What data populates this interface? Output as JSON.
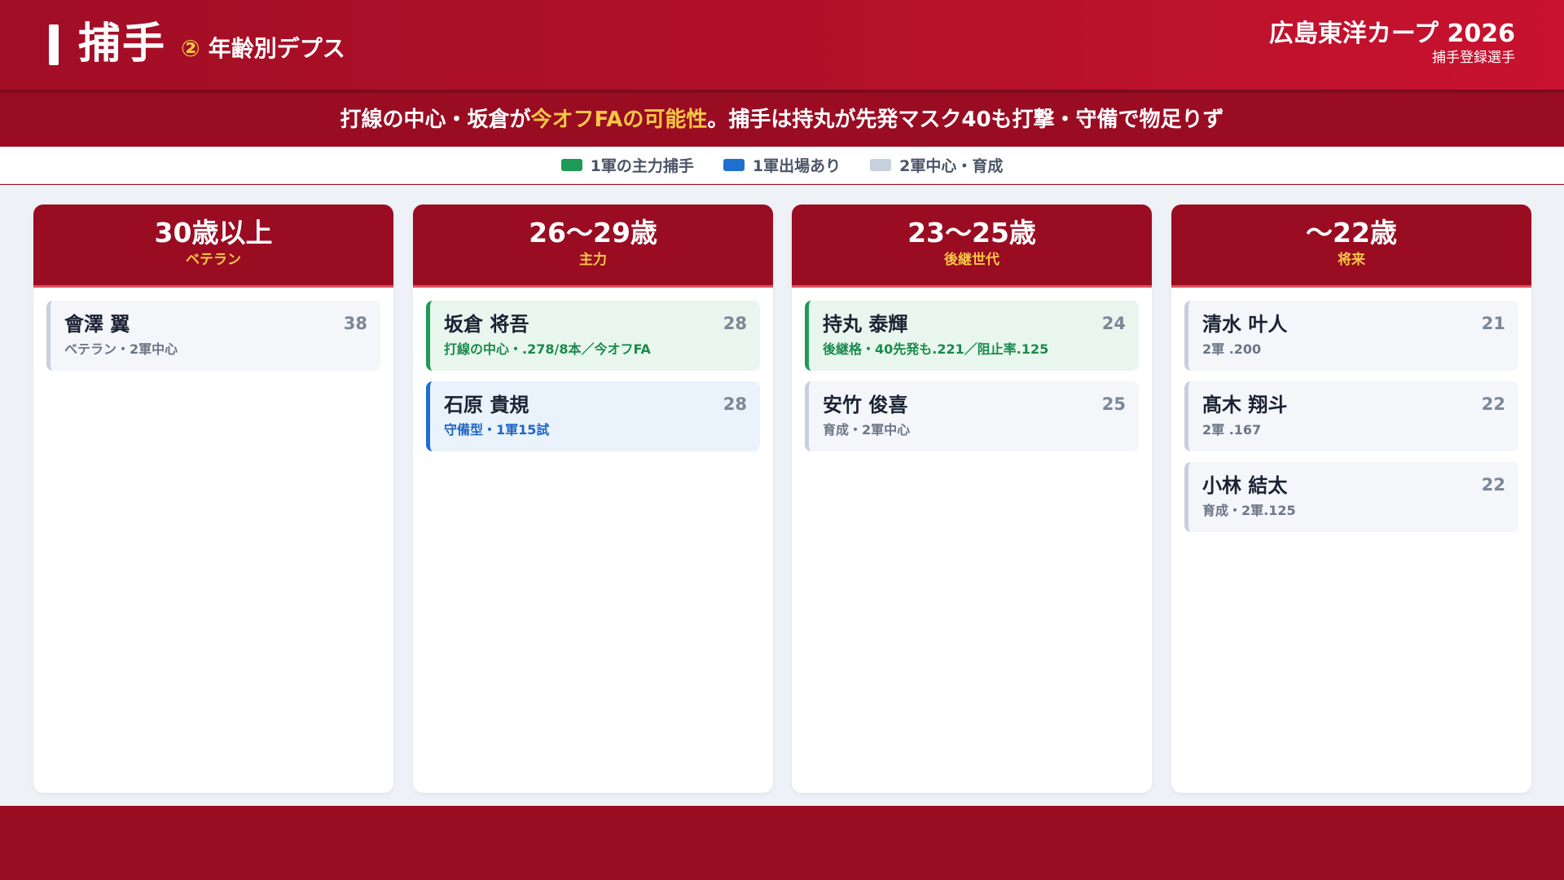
{
  "header": {
    "title": "捕手",
    "sub_num": "②",
    "sub_title": "年齢別デプス",
    "brand_name": "広島東洋カープ 2026",
    "brand_sub": "捕手登録選手"
  },
  "banner": {
    "part1": "打線の中心・坂倉が",
    "highlight": "今オフFAの可能性",
    "part2": "。捕手は持丸が先発マスク40も打撃・守備で物足りず"
  },
  "legend": [
    {
      "label": "1軍の主力捕手",
      "color": "#1f9a57"
    },
    {
      "label": "1軍出場あり",
      "color": "#1f6fd0"
    },
    {
      "label": "2軍中心・育成",
      "color": "#c7d0dd"
    }
  ],
  "columns": [
    {
      "title": "30歳以上",
      "sub": "ベテラン",
      "players": [
        {
          "name": "會澤 翼",
          "age": "38",
          "note": "ベテラン・2軍中心",
          "status": "gray"
        }
      ]
    },
    {
      "title": "26〜29歳",
      "sub": "主力",
      "players": [
        {
          "name": "坂倉 将吾",
          "age": "28",
          "note": "打線の中心・.278/8本／今オフFA",
          "status": "green"
        },
        {
          "name": "石原 貴規",
          "age": "28",
          "note": "守備型・1軍15試",
          "status": "blue"
        }
      ]
    },
    {
      "title": "23〜25歳",
      "sub": "後継世代",
      "players": [
        {
          "name": "持丸 泰輝",
          "age": "24",
          "note": "後継格・40先発も.221／阻止率.125",
          "status": "green"
        },
        {
          "name": "安竹 俊喜",
          "age": "25",
          "note": "育成・2軍中心",
          "status": "gray"
        }
      ]
    },
    {
      "title": "〜22歳",
      "sub": "将来",
      "players": [
        {
          "name": "清水 叶人",
          "age": "21",
          "note": "2軍 .200",
          "status": "gray"
        },
        {
          "name": "髙木 翔斗",
          "age": "22",
          "note": "2軍 .167",
          "status": "gray"
        },
        {
          "name": "小林 結太",
          "age": "22",
          "note": "育成・2軍.125",
          "status": "gray"
        }
      ]
    }
  ]
}
